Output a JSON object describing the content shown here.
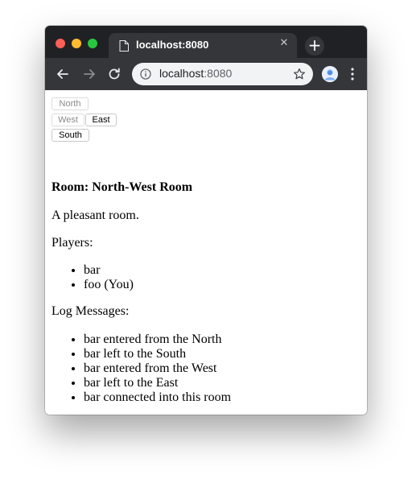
{
  "browser": {
    "tab_title": "localhost:8080",
    "url_host": "localhost",
    "url_port": ":8080",
    "close_glyph": "✕",
    "new_tab_glyph": "+",
    "icons": [
      "file-icon",
      "close-icon",
      "plus-icon",
      "back-arrow-icon",
      "forward-arrow-icon",
      "reload-icon",
      "info-icon",
      "star-icon",
      "avatar-icon",
      "menu-icon"
    ]
  },
  "navigation": {
    "north": "North",
    "west": "West",
    "east": "East",
    "south": "South"
  },
  "room": {
    "title": "Room: North-West Room",
    "description": "A pleasant room.",
    "players_label": "Players:",
    "players": [
      "bar",
      "foo (You)"
    ],
    "log_label": "Log Messages:",
    "logs": [
      "bar entered from the North",
      "bar left to the South",
      "bar entered from the West",
      "bar left to the East",
      "bar connected into this room"
    ]
  }
}
